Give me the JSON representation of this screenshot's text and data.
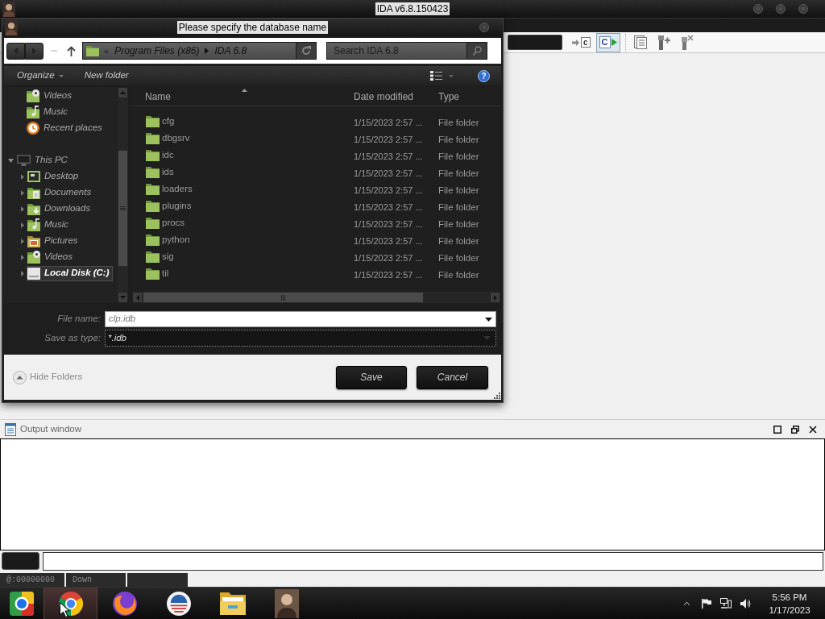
{
  "ida_window": {
    "title": "IDA v6.8.150423"
  },
  "toolbar": {
    "buttons": [
      {
        "kind": "jump",
        "glyph": "c",
        "pressed": false
      },
      {
        "kind": "run",
        "glyph": "C",
        "pressed": true
      },
      {
        "kind": "list",
        "pressed": false
      },
      {
        "kind": "plugin-add",
        "pressed": false
      },
      {
        "kind": "plugin-remove",
        "pressed": false
      }
    ]
  },
  "dialog": {
    "title": "Please specify the database name",
    "address_bar": {
      "overflow": "«",
      "path": [
        "Program Files (x86)",
        "IDA 6.8"
      ]
    },
    "search": {
      "placeholder": "Search IDA 6.8"
    },
    "command_bar": {
      "items": [
        {
          "label": "Organize",
          "kind": "menu"
        },
        {
          "label": "New folder",
          "kind": "button"
        }
      ],
      "help": "?"
    },
    "navigation_pane": {
      "quick_access": [
        {
          "label": "Videos",
          "kind": "videos",
          "selected": false
        },
        {
          "label": "Music",
          "kind": "music",
          "selected": false
        },
        {
          "label": "Recent places",
          "kind": "recent",
          "selected": false
        }
      ],
      "this_pc": {
        "label": "This PC",
        "expanded": true,
        "selected": false,
        "children": [
          {
            "label": "Desktop",
            "kind": "desktop",
            "expanded": false,
            "selected": false
          },
          {
            "label": "Documents",
            "kind": "documents",
            "expanded": false,
            "selected": false
          },
          {
            "label": "Downloads",
            "kind": "downloads",
            "expanded": false,
            "selected": false
          },
          {
            "label": "Music",
            "kind": "music",
            "expanded": false,
            "selected": false
          },
          {
            "label": "Pictures",
            "kind": "pictures",
            "expanded": false,
            "selected": false
          },
          {
            "label": "Videos",
            "kind": "videos",
            "expanded": false,
            "selected": false
          },
          {
            "label": "Local Disk (C:)",
            "kind": "disk",
            "expanded": false,
            "selected": true
          }
        ]
      }
    },
    "file_list": {
      "columns": [
        "Name",
        "Date modified",
        "Type"
      ],
      "rows": [
        {
          "name": "cfg",
          "date_modified": "1/15/2023 2:57 ...",
          "type": "File folder"
        },
        {
          "name": "dbgsrv",
          "date_modified": "1/15/2023 2:57 ...",
          "type": "File folder"
        },
        {
          "name": "idc",
          "date_modified": "1/15/2023 2:57 ...",
          "type": "File folder"
        },
        {
          "name": "ids",
          "date_modified": "1/15/2023 2:57 ...",
          "type": "File folder"
        },
        {
          "name": "loaders",
          "date_modified": "1/15/2023 2:57 ...",
          "type": "File folder"
        },
        {
          "name": "plugins",
          "date_modified": "1/15/2023 2:57 ...",
          "type": "File folder"
        },
        {
          "name": "procs",
          "date_modified": "1/15/2023 2:57 ...",
          "type": "File folder"
        },
        {
          "name": "python",
          "date_modified": "1/15/2023 2:57 ...",
          "type": "File folder"
        },
        {
          "name": "sig",
          "date_modified": "1/15/2023 2:57 ...",
          "type": "File folder"
        },
        {
          "name": "til",
          "date_modified": "1/15/2023 2:57 ...",
          "type": "File folder"
        }
      ]
    },
    "file_name": {
      "label": "File name:",
      "value": "clp.idb"
    },
    "save_as_type": {
      "label": "Save as type:",
      "value": "*.idb"
    },
    "hide_folders": "Hide Folders",
    "buttons": [
      "Save",
      "Cancel"
    ]
  },
  "output_window": {
    "title": "Output window"
  },
  "status_bar": [
    "@:00000000",
    "Down"
  ],
  "taskbar": {
    "apps": [
      {
        "kind": "square-ring",
        "highlighted": false
      },
      {
        "kind": "round-ring",
        "highlighted": true
      },
      {
        "kind": "globe",
        "highlighted": false
      },
      {
        "kind": "striped-circle",
        "highlighted": false
      },
      {
        "kind": "folder",
        "highlighted": false
      },
      {
        "kind": "portrait",
        "highlighted": false
      }
    ],
    "clock": {
      "time": "5:56 PM",
      "date": "1/17/2023"
    }
  }
}
